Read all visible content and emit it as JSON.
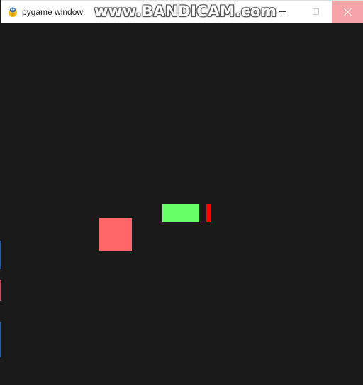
{
  "window": {
    "title": "pygame window",
    "watermark": "www.BANDICAM.com"
  },
  "icons": {
    "app": "pygame-snake-icon",
    "minimize": "minimize-icon",
    "maximize": "maximize-icon",
    "close": "close-icon"
  },
  "colors": {
    "background": "#1a1a1a",
    "player": "#66ff66",
    "bullet": "#ff0000",
    "enemy": "#ff6666",
    "close_hover": "#f7a3aa"
  }
}
